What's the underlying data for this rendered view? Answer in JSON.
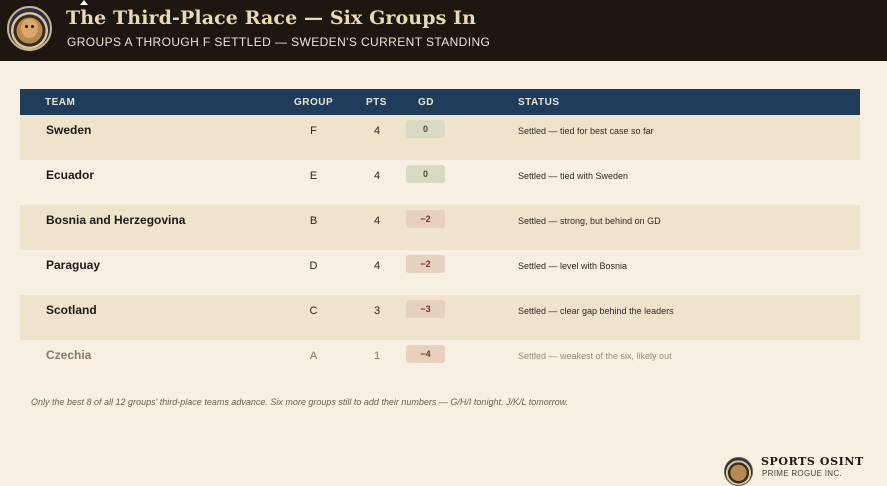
{
  "header": {
    "logo_icon": "bulldog-badge-icon",
    "title": "The Third-Place Race — Six Groups In",
    "subtitle": "GROUPS A THROUGH F SETTLED — SWEDEN'S CURRENT STANDING",
    "background_color": "#1d1611",
    "title_color": "#ecd9b4"
  },
  "table": {
    "header_color": "#1f3d5b",
    "columns": {
      "team": "TEAM",
      "group": "GROUP",
      "pts": "PTS",
      "gd": "GD",
      "status": "STATUS"
    },
    "rows": [
      {
        "team": "Sweden",
        "group": "F",
        "pts": "4",
        "gd": "0",
        "status": "Settled — tied for best case so far"
      },
      {
        "team": "Ecuador",
        "group": "E",
        "pts": "4",
        "gd": "0",
        "status": "Settled — tied with Sweden"
      },
      {
        "team": "Bosnia and Herzegovina",
        "group": "B",
        "pts": "4",
        "gd": "−2",
        "status": "Settled — strong, but behind on GD"
      },
      {
        "team": "Paraguay",
        "group": "D",
        "pts": "4",
        "gd": "−2",
        "status": "Settled — level with Bosnia"
      },
      {
        "team": "Scotland",
        "group": "C",
        "pts": "3",
        "gd": "−3",
        "status": "Settled — clear gap behind the leaders"
      },
      {
        "team": "Czechia",
        "group": "A",
        "pts": "1",
        "gd": "−4",
        "status": "Settled — weakest of the six, likely out"
      }
    ]
  },
  "footnote": "Only the best 8 of all 12 groups' third-place teams advance. Six more groups still to add their numbers — G/H/I tonight, J/K/L tomorrow.",
  "footer": {
    "logo_icon": "bulldog-badge-icon",
    "brand_name": "SPORTS OSINT",
    "brand_sub": "PRIME ROGUE INC."
  }
}
